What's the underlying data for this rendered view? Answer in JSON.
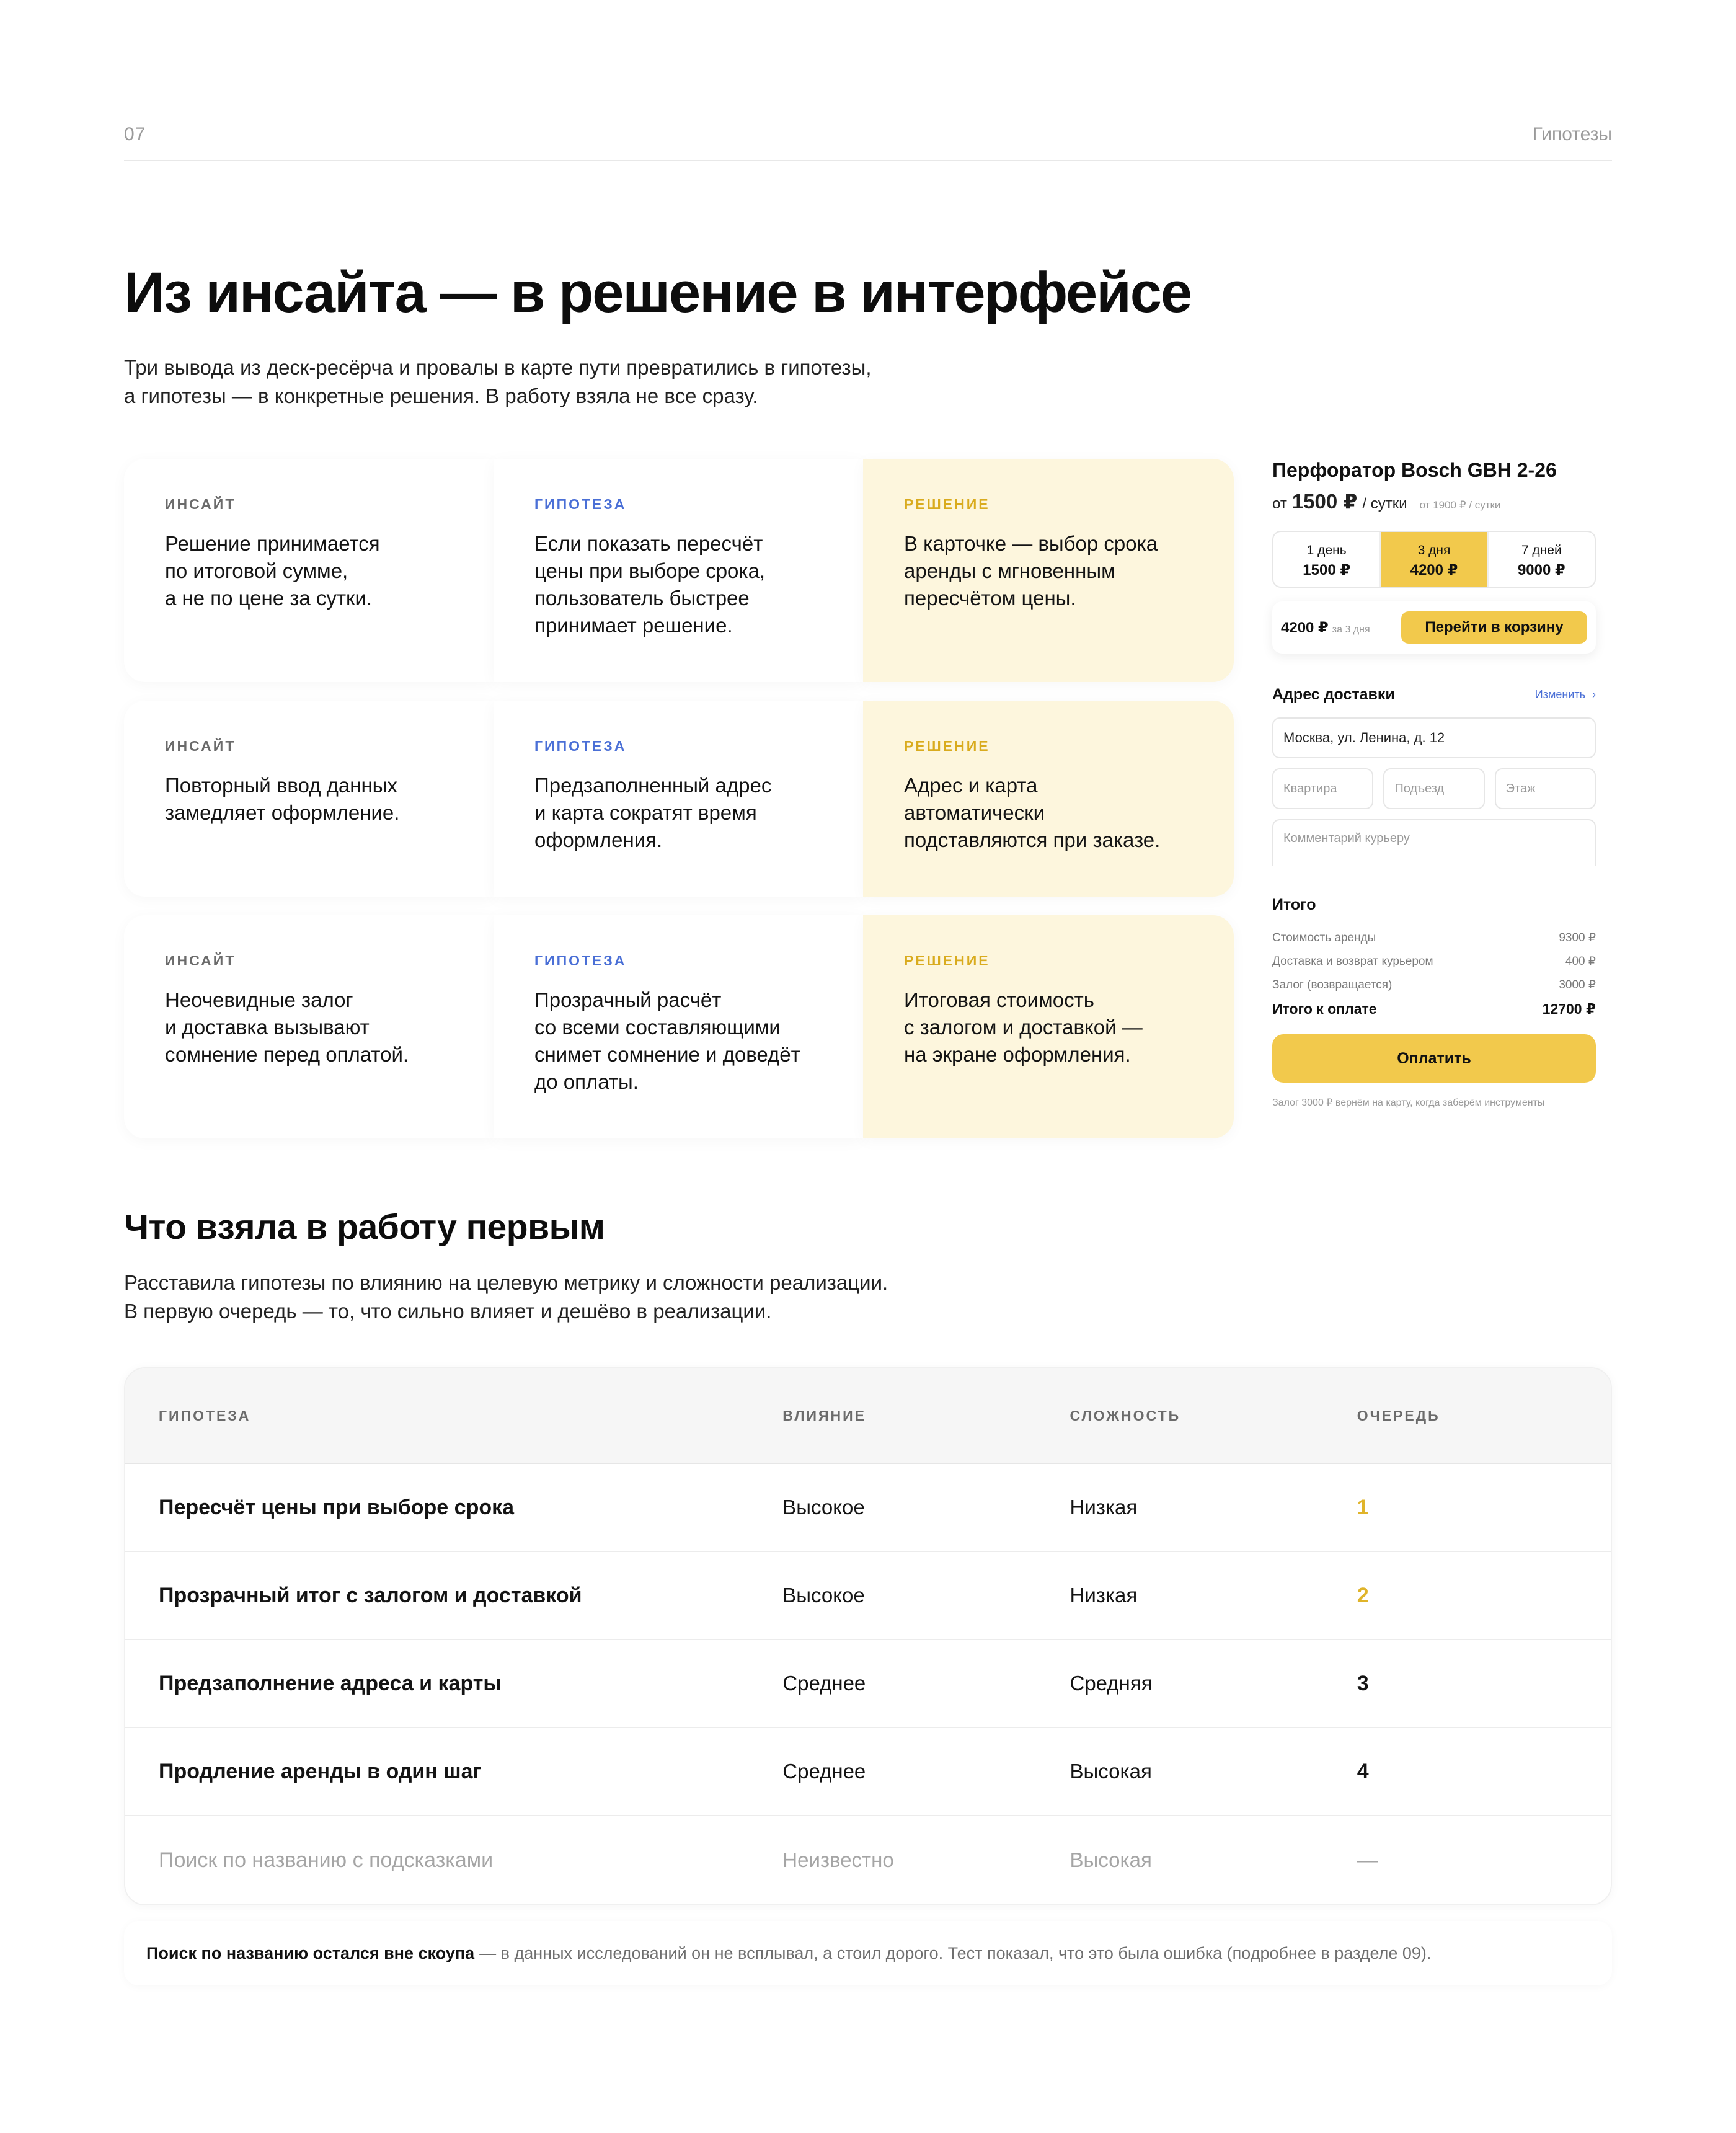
{
  "header": {
    "page_number": "07",
    "section": "Гипотезы"
  },
  "title": "Из инсайта — в решение в интерфейсе",
  "lead": [
    "Три вывода из деск-ресёрча и провалы в карте пути превратились в гипотезы,",
    "а гипотезы — в конкретные решения. В работу взяла не все сразу."
  ],
  "labels": {
    "insight": "ИНСАЙТ",
    "hypothesis": "ГИПОТЕЗА",
    "solution": "РЕШЕНИЕ"
  },
  "rows": [
    {
      "insight": [
        "Решение принимается",
        "по итоговой сумме,",
        "а не по цене за сутки."
      ],
      "hypothesis": [
        "Если показать пересчёт",
        "цены при выборе срока,",
        "пользователь быстрее",
        "принимает решение."
      ],
      "solution": [
        "В карточке — выбор срока",
        "аренды с мгновенным",
        "пересчётом цены."
      ]
    },
    {
      "insight": [
        "Повторный ввод данных",
        "замедляет оформление."
      ],
      "hypothesis": [
        "Предзаполненный адрес",
        "и карта сократят время",
        "оформления."
      ],
      "solution": [
        "Адрес и карта",
        "автоматически",
        "подставляются при заказе."
      ]
    },
    {
      "insight": [
        "Неочевидные залог",
        "и доставка вызывают",
        "сомнение перед оплатой."
      ],
      "hypothesis": [
        "Прозрачный расчёт",
        "со всеми составляющими",
        "снимет сомнение и доведёт",
        "до оплаты."
      ],
      "solution": [
        "Итоговая стоимость",
        "с залогом и доставкой —",
        "на экране оформления."
      ]
    }
  ],
  "widget": {
    "product": "Перфоратор Bosch GBH 2-26",
    "price_from": "от",
    "price": "1500 ₽",
    "price_unit": "/ сутки",
    "price_old": "от 1900 ₽ / сутки",
    "options": [
      {
        "days": "1 день",
        "price": "1500 ₽"
      },
      {
        "days": "3 дня",
        "price": "4200 ₽"
      },
      {
        "days": "7 дней",
        "price": "9000 ₽"
      }
    ],
    "cart_sum": "4200 ₽",
    "cart_period": "за 3 дня",
    "cart_button": "Перейти в корзину",
    "address_title": "Адрес доставки",
    "address_edit": "Изменить",
    "address_value": "Москва, ул. Ленина, д. 12",
    "apartment_placeholder": "Квартира",
    "entrance_placeholder": "Подъезд",
    "floor_placeholder": "Этаж",
    "comment_placeholder": "Комментарий курьеру",
    "summary_title": "Итого",
    "summary_lines": [
      {
        "label": "Стоимость аренды",
        "value": "9300 ₽"
      },
      {
        "label": "Доставка и возврат курьером",
        "value": "400 ₽"
      },
      {
        "label": "Залог (возвращается)",
        "value": "3000 ₽"
      }
    ],
    "total_label": "Итого к оплате",
    "total_value": "12700 ₽",
    "pay_button": "Оплатить",
    "pay_note": "Залог 3000 ₽ вернём на карту, когда заберём инструменты"
  },
  "priority": {
    "title": "Что взяла в работу первым",
    "lead": [
      "Расставила гипотезы по влиянию на целевую метрику и сложности реализации.",
      "В первую очередь — то, что сильно влияет и дешёво в реализации."
    ],
    "columns": [
      "ГИПОТЕЗА",
      "ВЛИЯНИЕ",
      "СЛОЖНОСТЬ",
      "ОЧЕРЕДЬ"
    ],
    "rows": [
      {
        "name": "Пересчёт цены при выборе срока",
        "impact": "Высокое",
        "complexity": "Низкая",
        "queue": "1"
      },
      {
        "name": "Прозрачный итог с залогом и доставкой",
        "impact": "Высокое",
        "complexity": "Низкая",
        "queue": "2"
      },
      {
        "name": "Предзаполнение адреса и карты",
        "impact": "Среднее",
        "complexity": "Средняя",
        "queue": "3"
      },
      {
        "name": "Продление аренды в один шаг",
        "impact": "Среднее",
        "complexity": "Высокая",
        "queue": "4"
      },
      {
        "name": "Поиск по названию с подсказками",
        "impact": "Неизвестно",
        "complexity": "Высокая",
        "queue": "—"
      }
    ]
  },
  "footnote": {
    "bold": "Поиск по названию остался вне скоупа",
    "rest": "— в данных исследований он не всплывал, а стоил дорого. Тест показал, что это была ошибка (подробнее в разделе 09)."
  },
  "colors": {
    "accent_yellow": "#f2c94c",
    "solution_bg": "#fdf6dd",
    "hypothesis_blue": "#4a6fd6",
    "solution_label": "#d9ab1e"
  }
}
